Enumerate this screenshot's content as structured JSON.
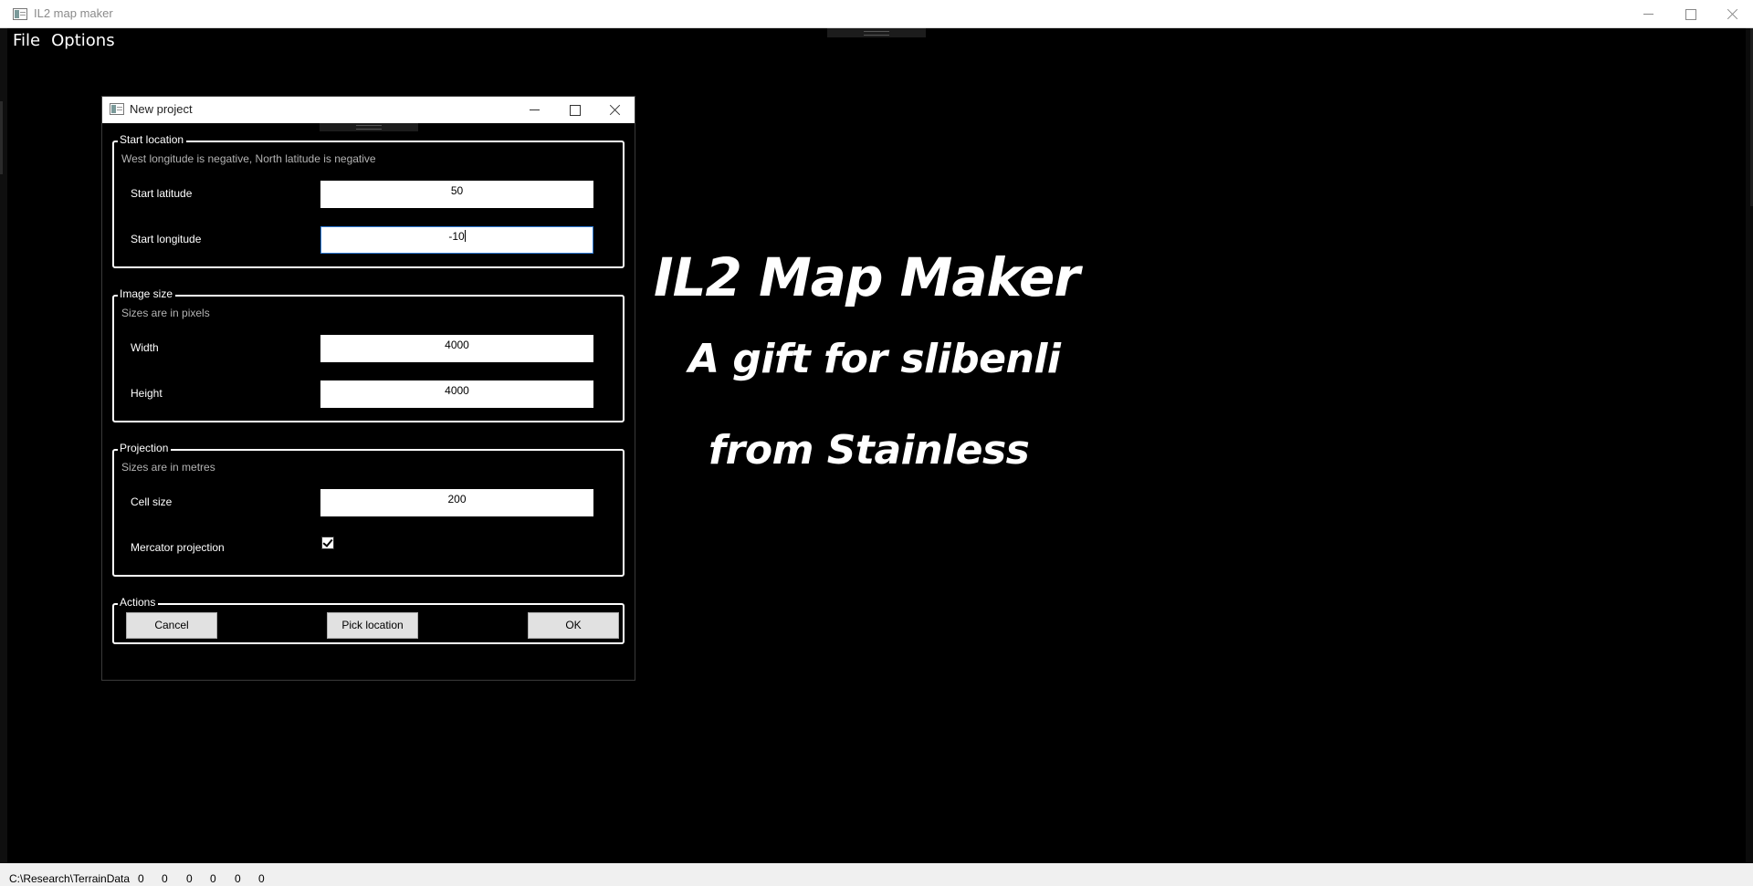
{
  "window": {
    "title": "IL2 map maker"
  },
  "menu": {
    "items": [
      "File",
      "Options"
    ]
  },
  "splash": {
    "title": "IL2 Map Maker",
    "line2": "A gift for slibenli",
    "line3": "from Stainless"
  },
  "dialog": {
    "title": "New project",
    "start_location": {
      "legend": "Start location",
      "description": "West longitude is negative, North latitude is negative",
      "latitude_label": "Start latitude",
      "latitude_value": "50",
      "longitude_label": "Start longitude",
      "longitude_value": "-10"
    },
    "image_size": {
      "legend": "Image size",
      "description": "Sizes are in pixels",
      "width_label": "Width",
      "width_value": "4000",
      "height_label": "Height",
      "height_value": "4000"
    },
    "projection": {
      "legend": "Projection",
      "description": "Sizes are in metres",
      "cell_size_label": "Cell size",
      "cell_size_value": "200",
      "mercator_label": "Mercator projection",
      "mercator_checked": true
    },
    "actions": {
      "legend": "Actions",
      "cancel_label": "Cancel",
      "pick_location_label": "Pick location",
      "ok_label": "OK"
    }
  },
  "statusbar": {
    "path": "C:\\Research\\TerrainData",
    "counters": [
      "0",
      "0",
      "0",
      "0",
      "0",
      "0"
    ]
  },
  "colors": {
    "background": "#000000",
    "focus_border": "#2f7bd6",
    "button_face": "#e1e1e1",
    "statusbar": "#f0f0f0"
  }
}
